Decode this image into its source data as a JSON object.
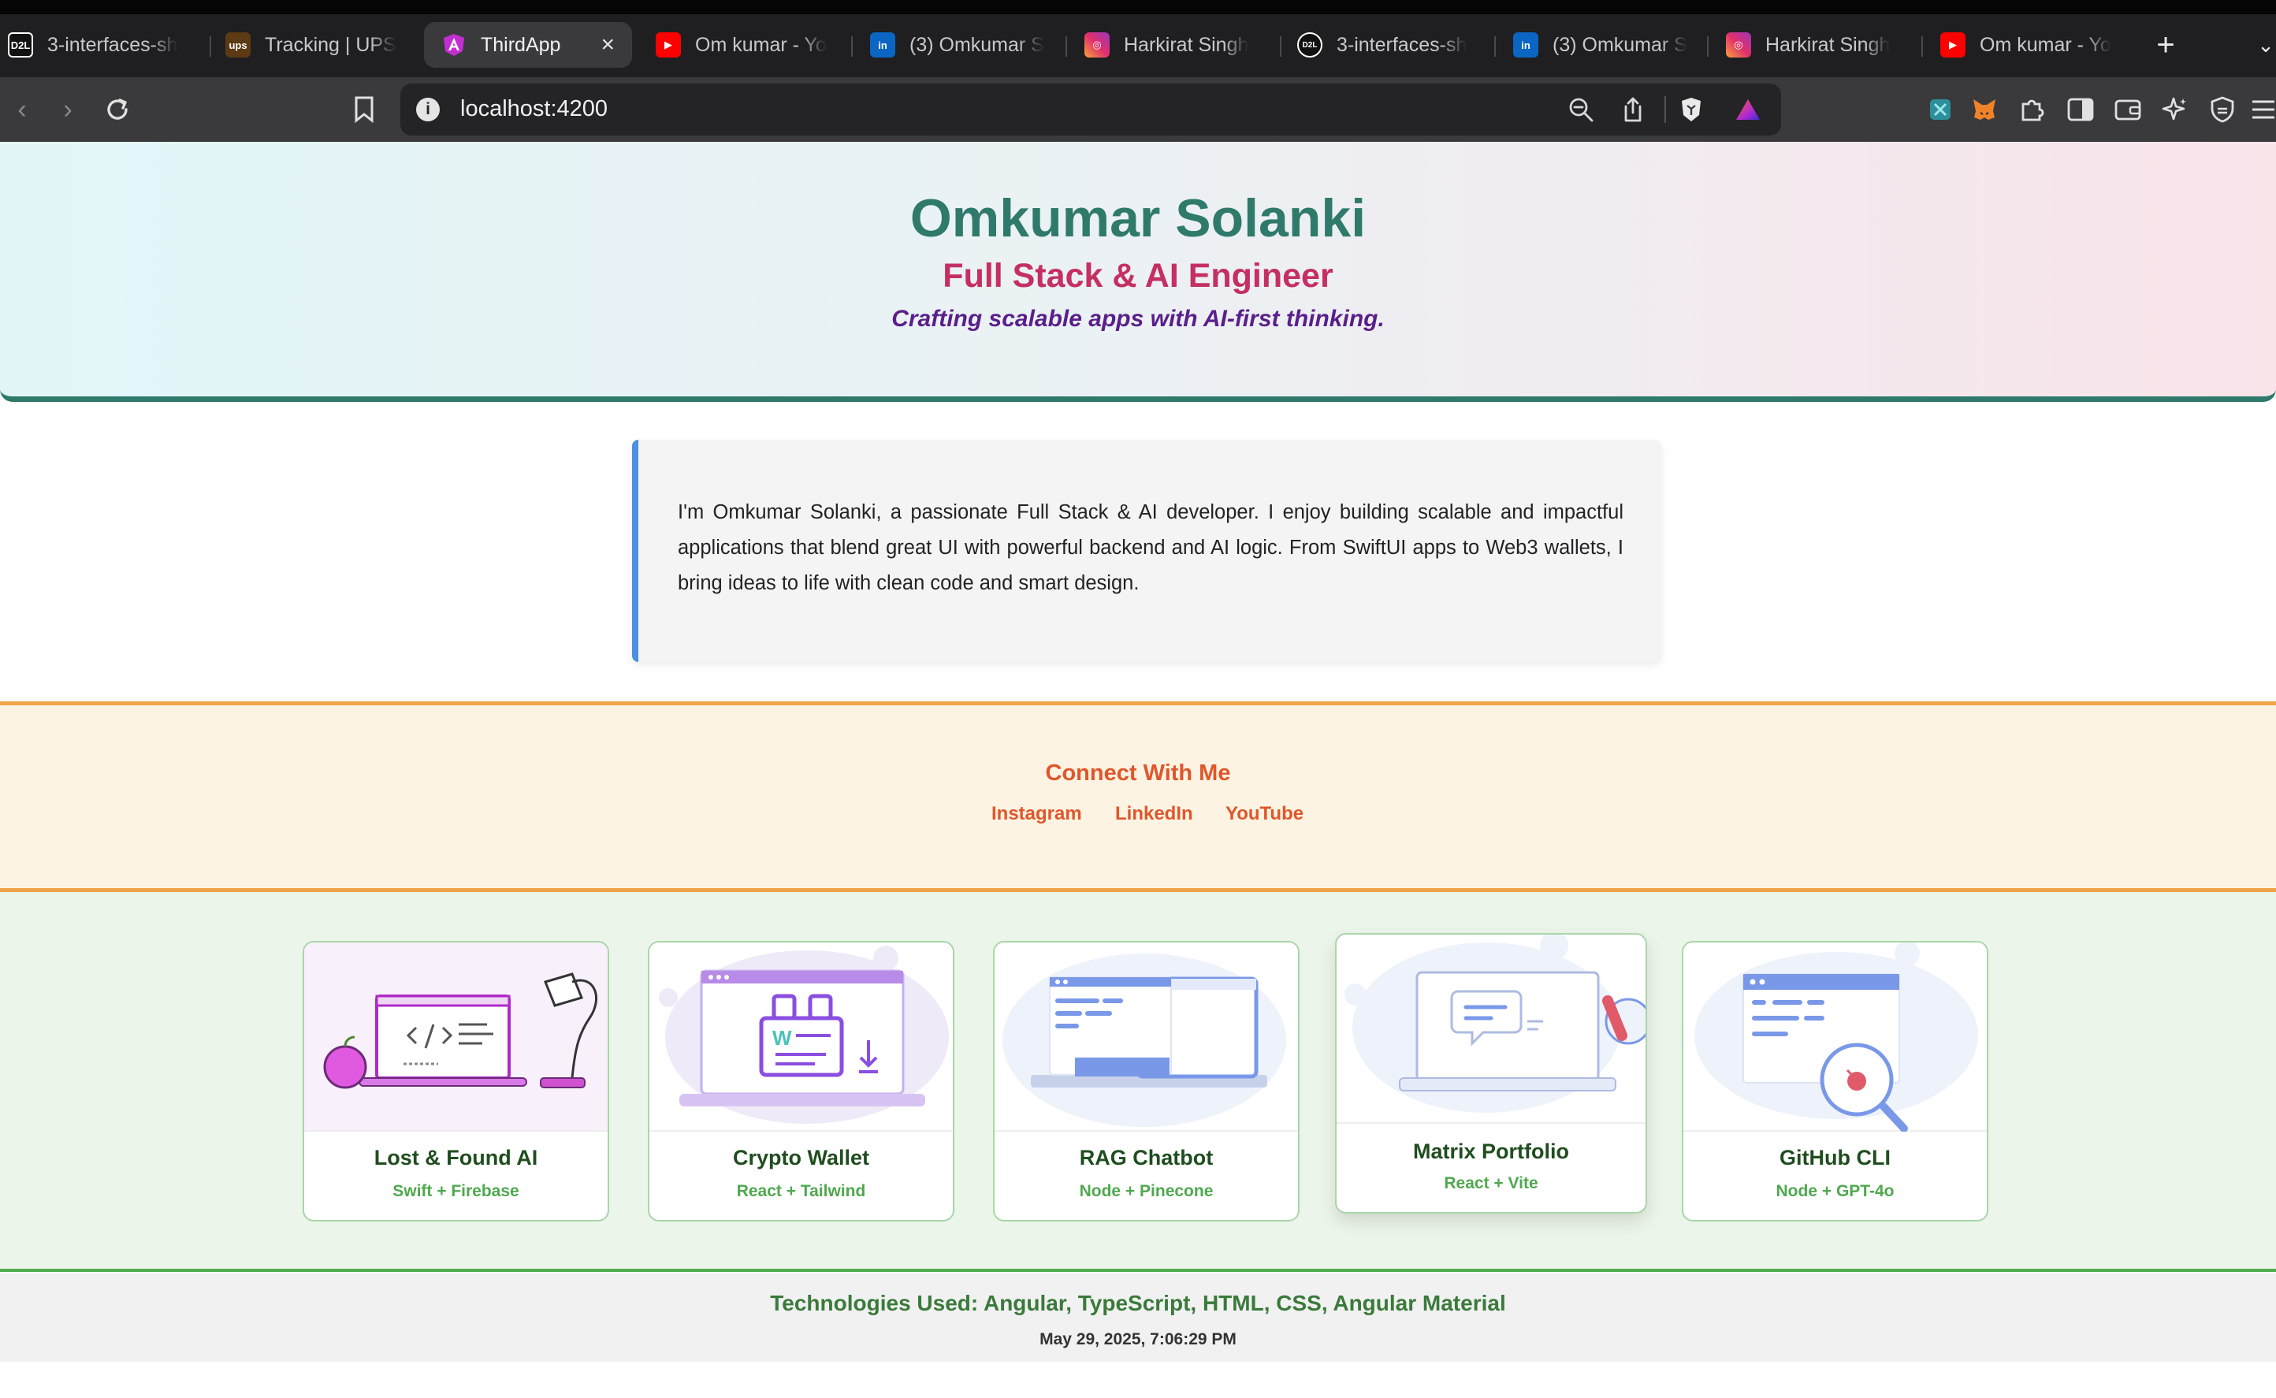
{
  "browser": {
    "tabs": [
      {
        "label": "3-interfaces-sh",
        "icon": "d2l-icon"
      },
      {
        "label": "Tracking | UPS",
        "icon": "ups-icon"
      },
      {
        "label": "ThirdApp",
        "icon": "angular-icon",
        "active": true
      },
      {
        "label": "Om kumar - Yo",
        "icon": "youtube-icon"
      },
      {
        "label": "(3) Omkumar S",
        "icon": "linkedin-icon"
      },
      {
        "label": "Harkirat Singh",
        "icon": "instagram-icon"
      },
      {
        "label": "3-interfaces-sh",
        "icon": "d2l-icon"
      },
      {
        "label": "(3) Omkumar S",
        "icon": "linkedin-icon"
      },
      {
        "label": "Harkirat Singh",
        "icon": "instagram-icon"
      },
      {
        "label": "Om kumar - Yo",
        "icon": "youtube-icon"
      }
    ],
    "url": "localhost:4200",
    "favicon_text": {
      "d2l": "D2L",
      "ups": "ups"
    }
  },
  "header": {
    "name": "Omkumar Solanki",
    "role": "Full Stack & AI Engineer",
    "tagline": "Crafting scalable apps with AI-first thinking."
  },
  "about": {
    "text": "I'm Omkumar Solanki, a passionate Full Stack & AI developer. I enjoy building scalable and impactful applications that blend great UI with powerful backend and AI logic. From SwiftUI apps to Web3 wallets, I bring ideas to life with clean code and smart design."
  },
  "connect": {
    "title": "Connect With Me",
    "links": [
      "Instagram",
      "LinkedIn",
      "YouTube"
    ]
  },
  "projects": [
    {
      "title": "Lost & Found AI",
      "stack": "Swift + Firebase"
    },
    {
      "title": "Crypto Wallet",
      "stack": "React + Tailwind"
    },
    {
      "title": "RAG Chatbot",
      "stack": "Node + Pinecone"
    },
    {
      "title": "Matrix Portfolio",
      "stack": "React + Vite"
    },
    {
      "title": "GitHub CLI",
      "stack": "Node + GPT-4o"
    }
  ],
  "footer": {
    "technologies": "Technologies Used: Angular, TypeScript, HTML, CSS, Angular Material",
    "timestamp": "May 29, 2025, 7:06:29 PM"
  },
  "colors": {
    "header_name": "#2f7a6a",
    "header_role": "#c52f62",
    "header_tagline": "#5a1f8a",
    "about_accent": "#4a8fe0",
    "connect_accent": "#e0562b",
    "projects_accent": "#4fad4f"
  }
}
